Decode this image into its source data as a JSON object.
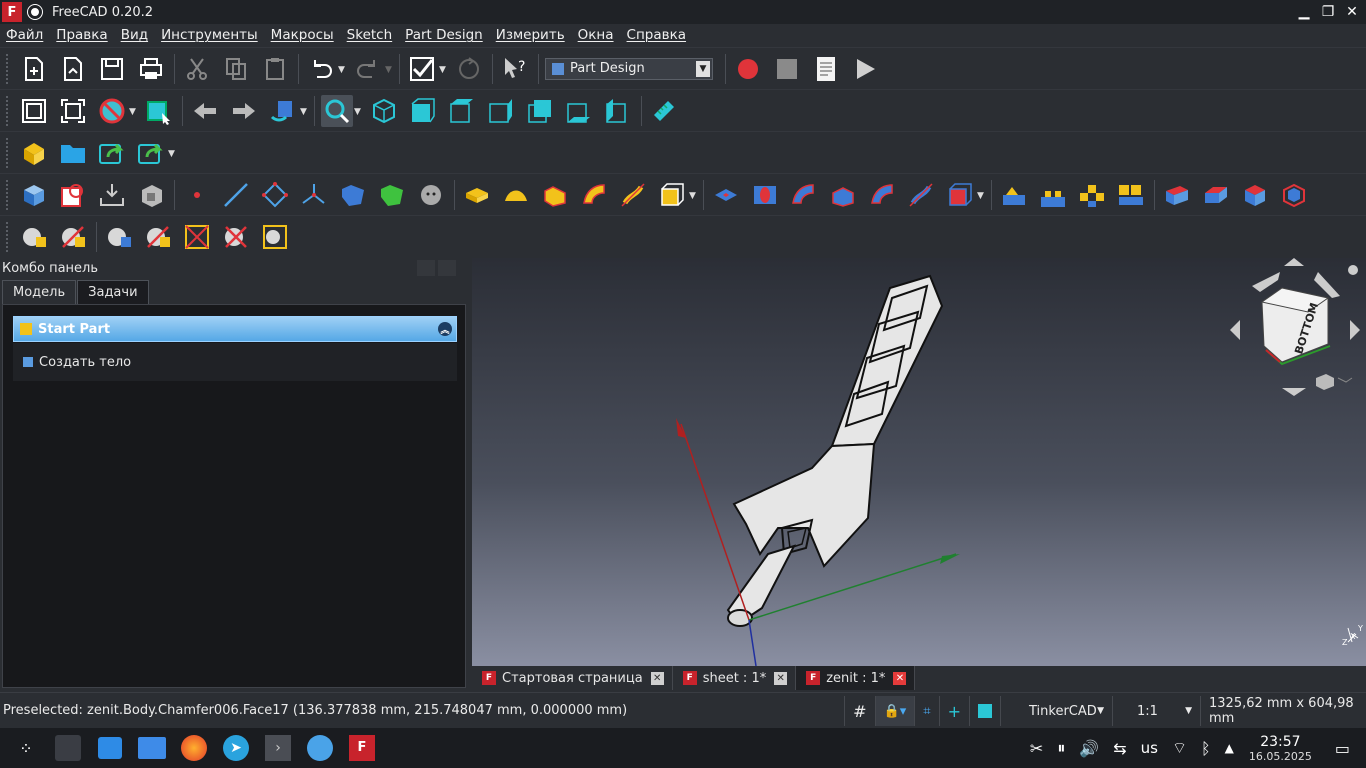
{
  "window": {
    "title": "FreeCAD 0.20.2",
    "minimize_icon": "minimize-icon",
    "maximize_icon": "maximize-icon",
    "close_icon": "close-icon"
  },
  "menu": [
    "Файл",
    "Правка",
    "Вид",
    "Инструменты",
    "Макросы",
    "Sketch",
    "Part Design",
    "Измерить",
    "Окна",
    "Справка"
  ],
  "workbench": {
    "selected": "Part Design"
  },
  "combo": {
    "title": "Комбо панель",
    "tabs": [
      "Модель",
      "Задачи"
    ],
    "active_tab": "Задачи",
    "start_part": "Start Part",
    "create_body": "Создать тело"
  },
  "navcube": {
    "face": "BOTTOM"
  },
  "doc_tabs": [
    {
      "label": "Стартовая страница",
      "active": false
    },
    {
      "label": "sheet : 1*",
      "active": false
    },
    {
      "label": "zenit : 1*",
      "active": true
    }
  ],
  "status": {
    "message": "Preselected: zenit.Body.Chamfer006.Face17 (136.377838 mm, 215.748047 mm, 0.000000 mm)",
    "nav_style": "TinkerCAD",
    "zoom": "1:1",
    "dimensions": "1325,62 mm x 604,98 mm"
  },
  "taskbar": {
    "keyboard": "us",
    "time": "23:57",
    "date": "16.05.2025"
  },
  "axis_labels": {
    "x": "X",
    "y": "Y",
    "z": "Z"
  },
  "colors": {
    "accent_select": "#55a8e6",
    "cad_red": "#c8232c",
    "cube_cyan": "#2bc7d6",
    "part_yellow": "#f2c21b"
  }
}
